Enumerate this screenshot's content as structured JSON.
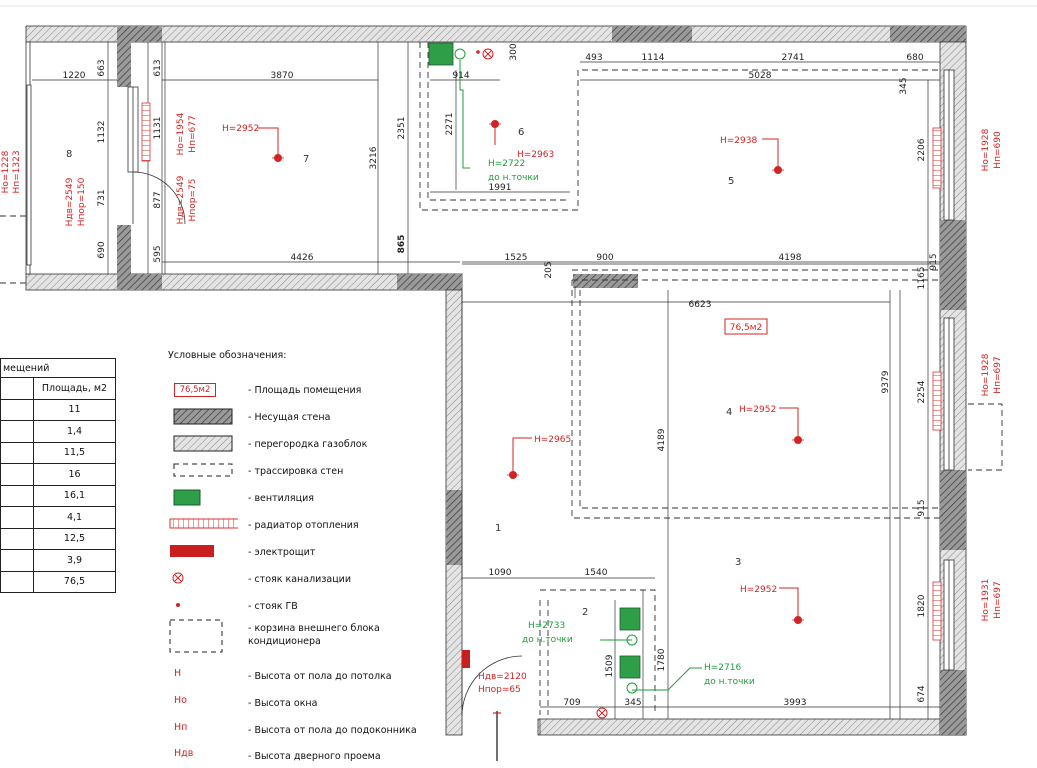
{
  "plan": {
    "room_numbers": [
      "1",
      "2",
      "3",
      "4",
      "5",
      "6",
      "7",
      "8"
    ],
    "area_badge": "76,5м2",
    "dimensions": {
      "d1220": "1220",
      "d663": "663",
      "d613": "613",
      "d3870": "3870",
      "d914": "914",
      "d300": "300",
      "d493": "493",
      "d1114": "1114",
      "d2741": "2741",
      "d680": "680",
      "d5028": "5028",
      "d345a": "345",
      "d1132": "1132",
      "d1131": "1131",
      "d2271": "2271",
      "d2351": "2351",
      "d3216": "3216",
      "d2206": "2206",
      "d731": "731",
      "d877": "877",
      "d1991": "1991",
      "d690": "690",
      "d595": "595",
      "d4426": "4426",
      "d865": "865",
      "d1525": "1525",
      "d205": "205",
      "d900": "900",
      "d4198": "4198",
      "d1165": "1165",
      "d915a": "915",
      "d6623": "6623",
      "d9379": "9379",
      "d2254": "2254",
      "d4189": "4189",
      "d915b": "915",
      "d1090": "1090",
      "d1540": "1540",
      "d1509": "1509",
      "d1780": "1780",
      "d1820": "1820",
      "d709": "709",
      "d345b": "345",
      "d3993": "3993",
      "d674": "674"
    },
    "heights": {
      "h7": "H=2952",
      "h6": "H=2963",
      "h5": "H=2938",
      "h4": "H=2952",
      "h1": "H=2965",
      "h3": "H=2952"
    },
    "green_notes": {
      "g6a": "H=2722",
      "g6b": "до н.точки",
      "g2a": "H=2733",
      "g2b": "до н.точки",
      "g3a": "H=2716",
      "g3b": "до н.точки"
    },
    "window_notes": {
      "w8a": "Но=1228",
      "w8b": "Нп=1323",
      "w8c": "Ндв=2549",
      "w8d": "Нпор=150",
      "w7a": "Но=1954",
      "w7b": "Нп=677",
      "w7c": "Ндв=2549",
      "w7d": "Нпор=75",
      "w5a": "Но=1928",
      "w5b": "Нп=690",
      "w4a": "Но=1928",
      "w4b": "Нп=697",
      "w3a": "Но=1931",
      "w3b": "Нп=697",
      "door_a": "Ндв=2120",
      "door_b": "Нпор=65"
    }
  },
  "room_table": {
    "title_fragment": "мещений",
    "area_header": "Площадь, м2",
    "areas": [
      "11",
      "1,4",
      "11,5",
      "16",
      "16,1",
      "4,1",
      "12,5",
      "3,9",
      "76,5"
    ]
  },
  "legend": {
    "title": "Условные обозначения:",
    "items": [
      {
        "name": "area",
        "text": "- Площадь помещения",
        "sample": "76,5м2"
      },
      {
        "name": "bearing-wall",
        "text": "- Несущая  стена"
      },
      {
        "name": "partition",
        "text": "- перегородка газоблок"
      },
      {
        "name": "wall-tracing",
        "text": "- трассировка стен"
      },
      {
        "name": "ventilation",
        "text": "- вентиляция"
      },
      {
        "name": "radiator",
        "text": "- радиатор отопления"
      },
      {
        "name": "electric-panel",
        "text": "- электрощит"
      },
      {
        "name": "sewer-riser",
        "text": "- стояк канализации"
      },
      {
        "name": "hot-water-riser",
        "text": "- стояк ГВ"
      },
      {
        "name": "ac-basket",
        "text": "- корзина внешнего блока кондиционера"
      },
      {
        "name": "h",
        "text": "- Высота от пола до потолка",
        "sample": "Н"
      },
      {
        "name": "ho",
        "text": "- Высота окна",
        "sample": "Но"
      },
      {
        "name": "hp",
        "text": "- Высота от пола до подоконника",
        "sample": "Нп"
      },
      {
        "name": "hdv",
        "text": "- Высота дверного проема",
        "sample": "Ндв"
      }
    ]
  },
  "colors": {
    "red": "#d22424",
    "green": "#1d9e3a",
    "wall_fill": "#a9a9a9",
    "radiator": "#e03232"
  }
}
